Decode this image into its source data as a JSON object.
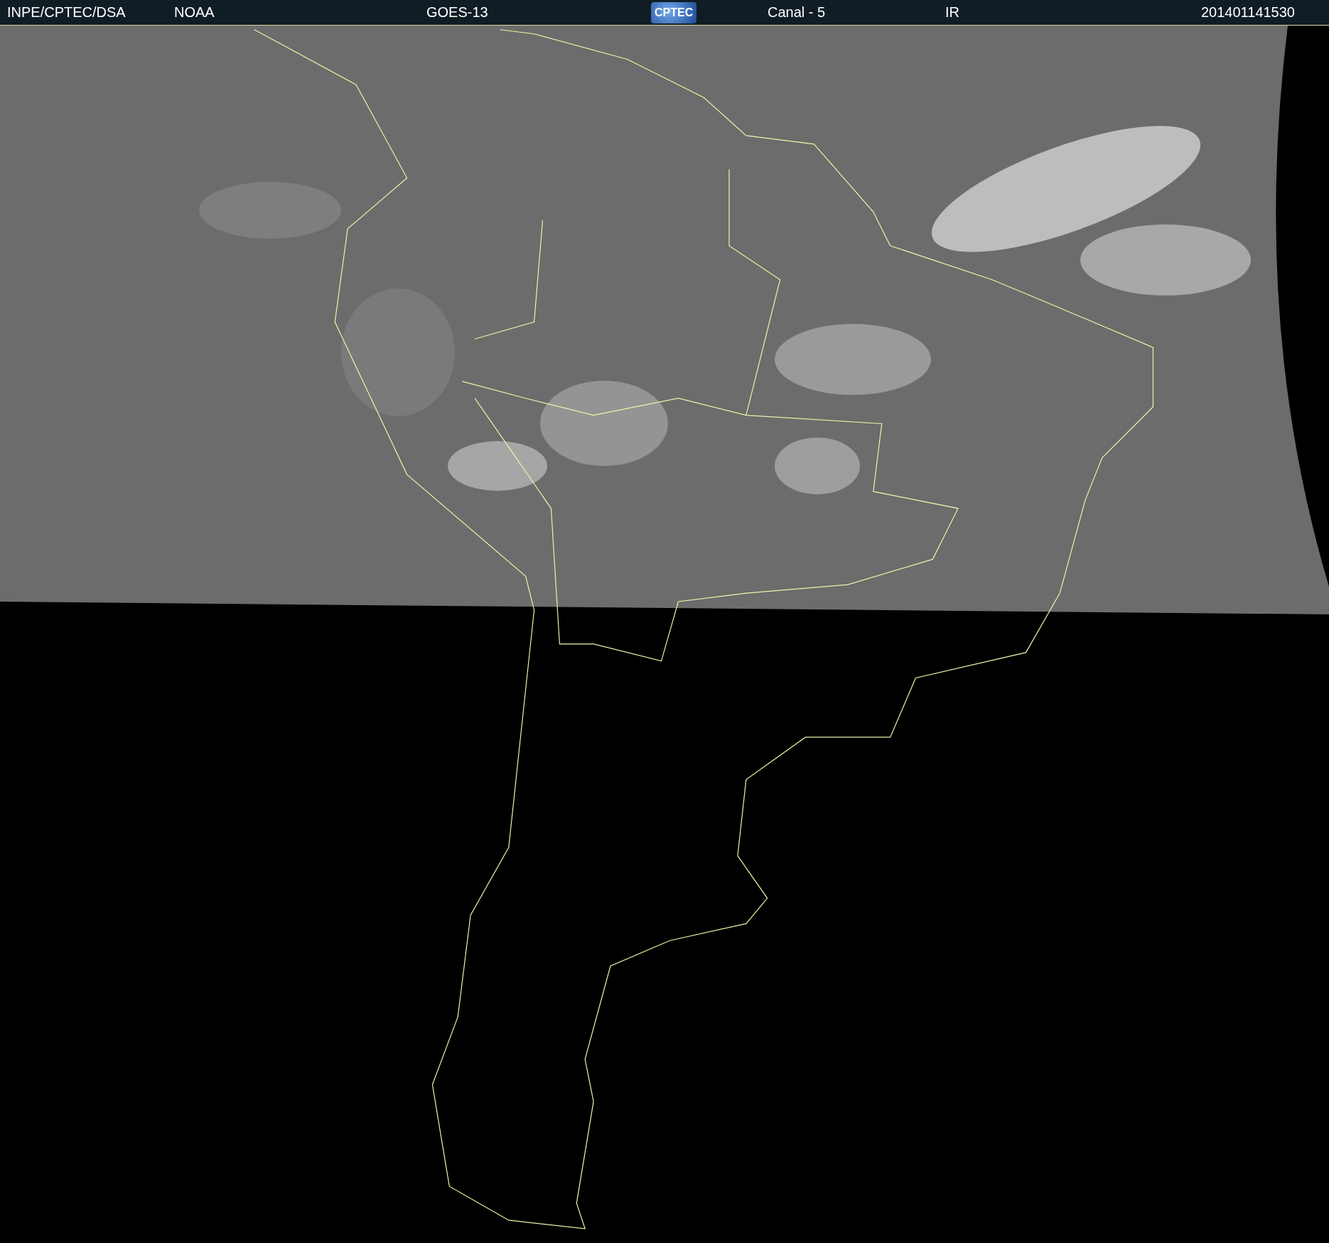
{
  "header": {
    "items": [
      {
        "kind": "text",
        "text": "INPE/CPTEC/DSA"
      },
      {
        "kind": "text",
        "text": "NOAA"
      },
      {
        "kind": "text",
        "text": "GOES-13"
      },
      {
        "kind": "logo",
        "text": "CPTEC"
      },
      {
        "kind": "text",
        "text": "Canal - 5"
      },
      {
        "kind": "text",
        "text": "IR"
      },
      {
        "kind": "text",
        "text": "201401141530"
      }
    ]
  }
}
